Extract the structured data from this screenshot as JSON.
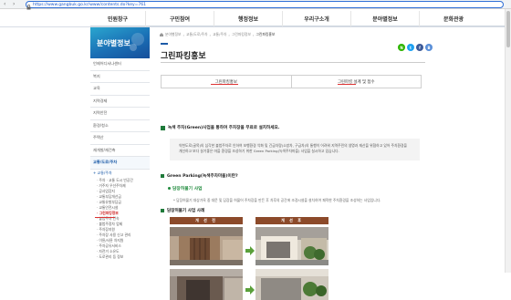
{
  "browser": {
    "url": "https://www.gangbuk.go.kr/www/contents.do?key=761"
  },
  "topmenu": {
    "items": [
      "민원창구",
      "구민참여",
      "행정정보",
      "우리구소개",
      "분야별정보",
      "문화관광"
    ]
  },
  "sidebar": {
    "title": "분야별정보",
    "items": [
      "언제어디서나센터",
      "복지",
      "교육",
      "지역경제",
      "지역안전",
      "환경/청소",
      "주택산",
      "재개발/재건축",
      "교통/도로/주차"
    ],
    "active_index": 8,
    "sub_head": "+ 교통/주차",
    "sub_items": [
      "· 주차 · 교통 도시 빈공간",
      "· 거주자 우선주차제",
      "· 공사업장지",
      "· 교통부담개선금",
      "· 교통유발부담금",
      "· 교통안전시설",
      "· 그린파킹정보",
      "· 불법주차 단속",
      "· 불법주정차 업제",
      "· 주차장지원",
      "· 주차장 사용 신고 관리",
      "· 이륜/사륜 차지원",
      "· 주차공유서비스",
      "· 자전거 소유도",
      "· 도로관리 등 정보"
    ],
    "sub_active_index": 6
  },
  "content": {
    "breadcrumb": [
      "분야별정보",
      "교통/도로/주차",
      "교통/주차",
      "그린파킹정보",
      "그린파킹홍보"
    ],
    "page_title": "그린파킹홍보",
    "social": [
      "N",
      "t",
      "f",
      "B"
    ],
    "tabs": [
      "그린파킹홍보",
      "그린파킹 설계 및 접수"
    ],
    "section1_title": "녹색 주차(Green)사업을 통하여 주차장을 무료로 설치하세요.",
    "notice_lines": [
      "약천도로(골목)의 심각한 불법주차로 인하여 보행환경 악화 및 긴급차량(소방차, 구급차)의 통행이 어려워 지역주민의 생명과 재산을 위협하고 있어 주차환경을",
      "개선하고 보다 살기좋은 마을 환경을 조성하기 위한 Green Parking(녹색주차마을) 사업을 실시하고 있습니다."
    ],
    "section2_title": "Green Parking(녹색주차마을)이란?",
    "green_title": "담장허물기 사업",
    "desc": "* 담장허물기 대상가옥 중 대문 및 담장을 허물어 주차장을 만든 후 차후의 공간에 조경시설을 설치하여 쾌적한 주차환경을 조성하는 사업입니다.",
    "section3_title": "담장허물기 사업 사례",
    "before_label": "개 선 전",
    "after_label": "개 선 후"
  },
  "colors": {
    "accent_blue": "#1c5ba8",
    "accent_green": "#1f7a3a",
    "photo_header": "#8c4a2a",
    "underline_red": "#dd3333"
  }
}
